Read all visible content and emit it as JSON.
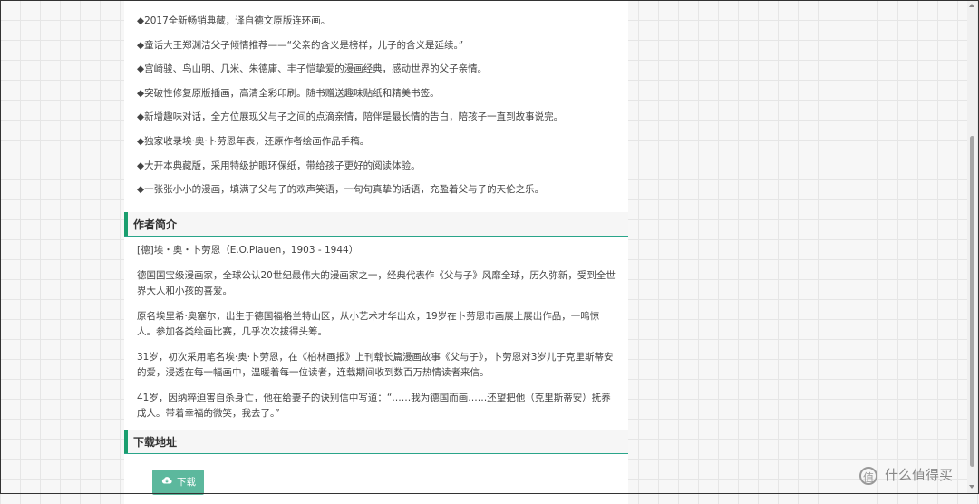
{
  "features": [
    "◆2017全新畅销典藏，译自德文原版连环画。",
    "◆童话大王郑渊洁父子倾情推荐——“父亲的含义是榜样，儿子的含义是延续。”",
    "◆宫崎骏、鸟山明、几米、朱德庸、丰子恺挚爱的漫画经典，感动世界的父子亲情。",
    "◆突破性修复原版插画，高清全彩印刷。随书赠送趣味贴纸和精美书签。",
    "◆新增趣味对话，全方位展现父与子之间的点滴亲情，陪伴是最长情的告白，陪孩子一直到故事说完。",
    "◆独家收录埃·奥·卜劳恩年表，还原作者绘画作品手稿。",
    "◆大开本典藏版，采用特级护眼环保纸，带给孩子更好的阅读体验。",
    "◆一张张小小的漫画，填满了父与子的欢声笑语，一句句真挚的话语，充盈着父与子的天伦之乐。"
  ],
  "author_section": {
    "title": "作者简介",
    "paragraphs": [
      "[德]埃・奥・卜劳恩（E.O.Plauen，1903 - 1944）",
      "德国国宝级漫画家，全球公认20世纪最伟大的漫画家之一，经典代表作《父与子》风靡全球，历久弥新，受到全世界大人和小孩的喜爱。",
      "原名埃里希·奥塞尔，出生于德国福格兰特山区，从小艺术才华出众，19岁在卜劳恩市画展上展出作品，一鸣惊人。参加各类绘画比赛，几乎次次拔得头筹。",
      "31岁，初次采用笔名埃·奥·卜劳恩，在《柏林画报》上刊载长篇漫画故事《父与子》，卜劳恩对3岁儿子克里斯蒂安的爱，浸透在每一幅画中，温暖着每一位读者，连载期间收到数百万热情读者来信。",
      "41岁，因纳粹迫害自杀身亡，他在给妻子的诀别信中写道：“……我为德国而画……还望把他（克里斯蒂安）抚养成人。带着幸福的微笑，我去了。”"
    ]
  },
  "download_section": {
    "title": "下载地址",
    "button_label": "下载",
    "button_icon": "cloud-download-icon"
  },
  "watermark": {
    "logo_glyph": "值",
    "text": "什么值得买"
  },
  "colors": {
    "accent": "#1a9e6e",
    "button": "#5cb89d",
    "heading_rule": "#2aa58a"
  }
}
